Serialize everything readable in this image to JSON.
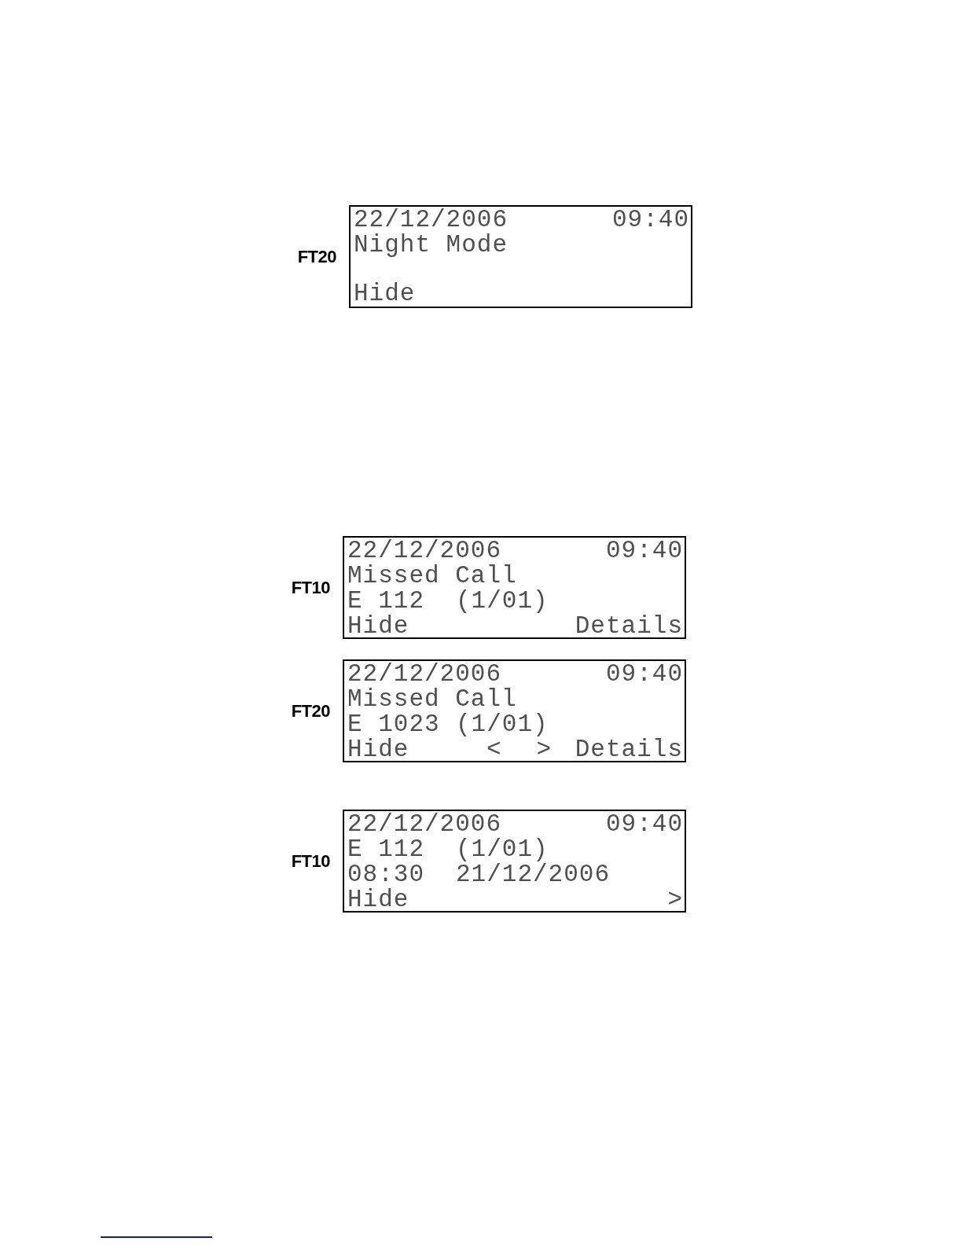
{
  "figures": [
    {
      "screens": [
        {
          "model": "FT20",
          "date": "22/12/2006",
          "time": "09:40",
          "lines": [
            [
              "Night Mode"
            ]
          ],
          "softkeys": {
            "left": "Hide"
          }
        }
      ]
    },
    {
      "screens": [
        {
          "model": "FT10",
          "date": "22/12/2006",
          "time": "09:40",
          "lines": [
            [
              "Missed Call"
            ],
            [
              "E 112",
              "(1/01)"
            ]
          ],
          "softkeys": {
            "left": "Hide",
            "right": "Details"
          }
        },
        {
          "model": "FT20",
          "date": "22/12/2006",
          "time": "09:40",
          "lines": [
            [
              "Missed Call"
            ],
            [
              "E 1023",
              "(1/01)"
            ]
          ],
          "softkeys": {
            "left": "Hide",
            "nav": [
              "<",
              ">"
            ],
            "right": "Details"
          }
        }
      ]
    },
    {
      "screens": [
        {
          "model": "FT10",
          "date": "22/12/2006",
          "time": "09:40",
          "lines": [
            [
              "E 112",
              "(1/01)"
            ],
            [
              "08:30",
              "21/12/2006"
            ]
          ],
          "softkeys": {
            "left": "Hide",
            "right": ">"
          }
        }
      ]
    }
  ]
}
